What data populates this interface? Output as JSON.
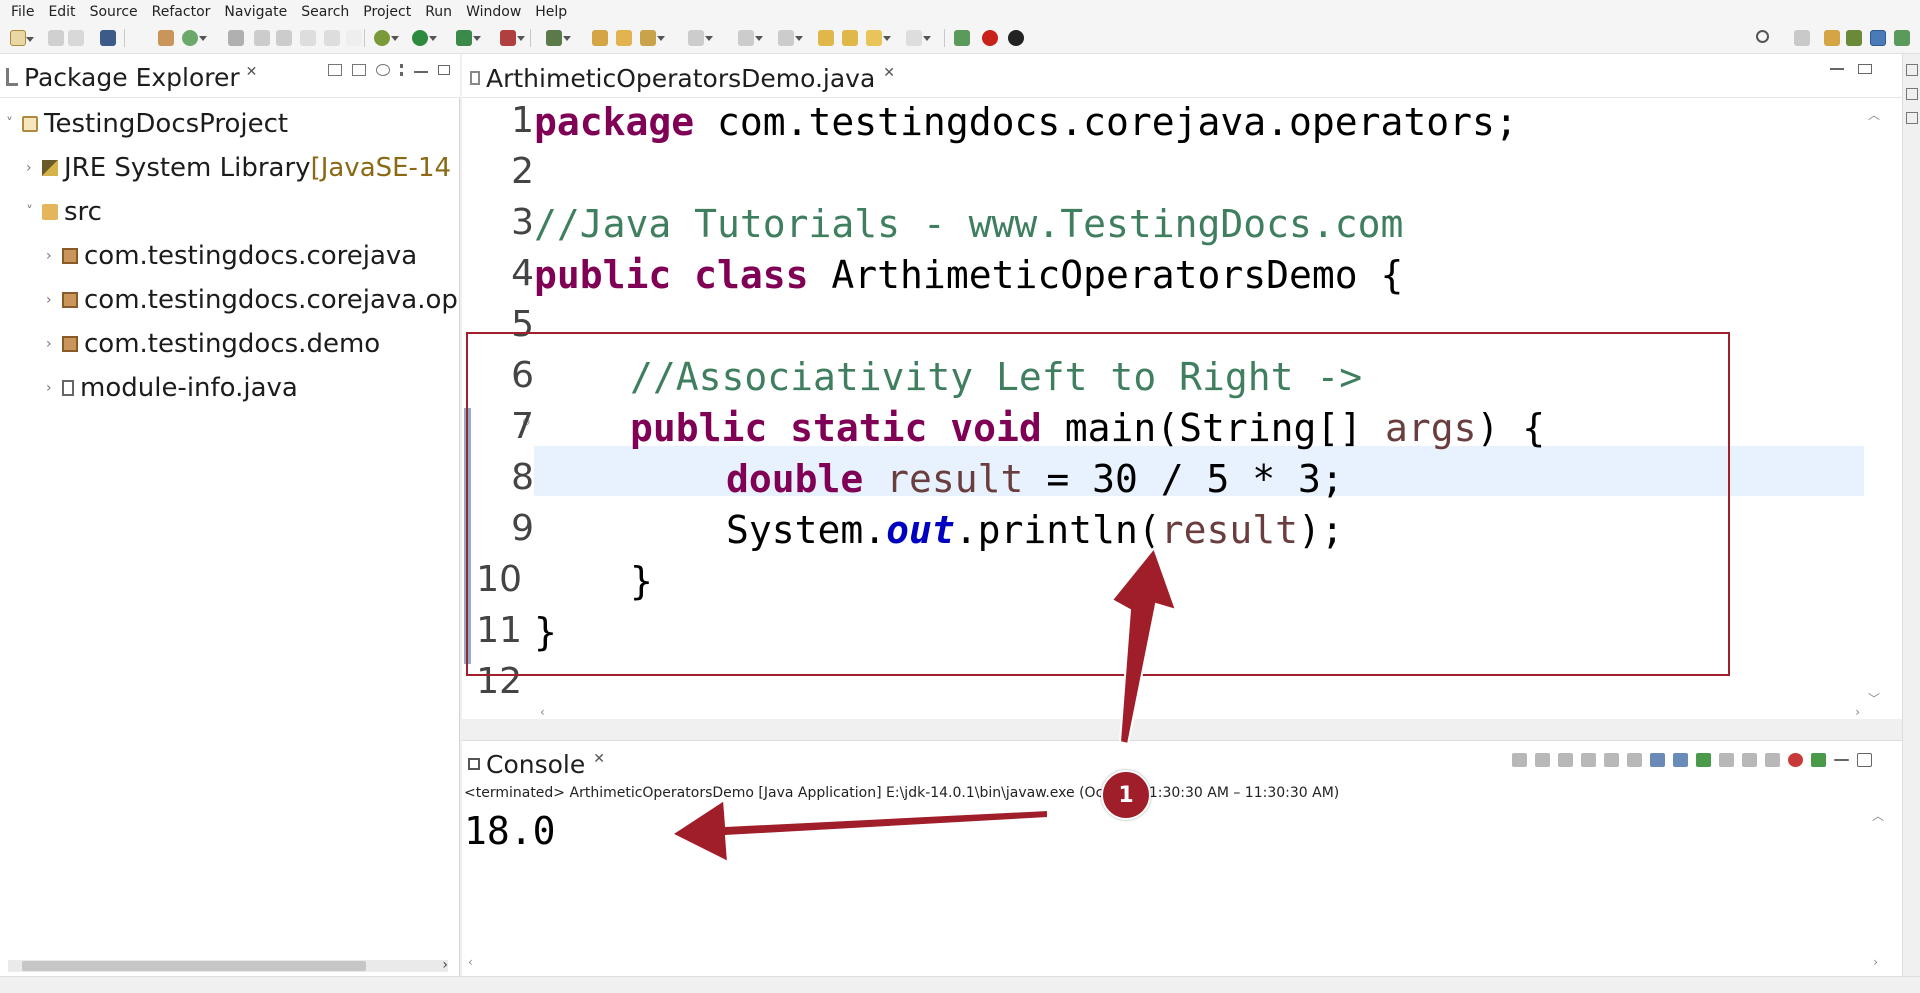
{
  "menu": [
    "File",
    "Edit",
    "Source",
    "Refactor",
    "Navigate",
    "Search",
    "Project",
    "Run",
    "Window",
    "Help"
  ],
  "package_explorer": {
    "title": "Package Explorer",
    "tree": [
      {
        "label": "TestingDocsProject",
        "suffix": "",
        "icon": "project-icon",
        "twisty": "˅"
      },
      {
        "label": "JRE System Library ",
        "suffix": "[JavaSE-14",
        "icon": "library-icon",
        "twisty": "›"
      },
      {
        "label": "src",
        "suffix": "",
        "icon": "source-folder-icon",
        "twisty": "˅"
      },
      {
        "label": "com.testingdocs.corejava",
        "suffix": "",
        "icon": "package-icon",
        "twisty": "›"
      },
      {
        "label": "com.testingdocs.corejava.op",
        "suffix": "",
        "icon": "package-icon",
        "twisty": "›"
      },
      {
        "label": "com.testingdocs.demo",
        "suffix": "",
        "icon": "package-icon",
        "twisty": "›"
      },
      {
        "label": "module-info.java",
        "suffix": "",
        "icon": "java-file-icon",
        "twisty": "›"
      }
    ]
  },
  "editor": {
    "tab_title": "ArthimeticOperatorsDemo.java",
    "line_numbers": [
      "1",
      "2",
      "3",
      "4",
      "5",
      "6",
      "7",
      "8",
      "9",
      "10",
      "11",
      "12"
    ],
    "lines": {
      "l1_kw": "package",
      "l1_rest": " com.testingdocs.corejava.operators;",
      "l3_comment": "//Java Tutorials - www.TestingDocs.com",
      "l4_kw": "public class",
      "l4_rest": " ArthimeticOperatorsDemo {",
      "l6_comment": "//Associativity Left to Right ->",
      "l7_kw": "public static void",
      "l7_mid": " main(String[] ",
      "l7_var": "args",
      "l7_end": ") {",
      "l8_kw": "double",
      "l8_sp": " ",
      "l8_var": "result",
      "l8_rest": " = 30 / 5 * 3;",
      "l9_a": "System.",
      "l9_field": "out",
      "l9_b": ".println(",
      "l9_var": "result",
      "l9_c": ");",
      "l10": "}",
      "l11": "}"
    }
  },
  "console": {
    "title": "Console",
    "status": "<terminated> ArthimeticOperatorsDemo [Java Application] E:\\jdk-14.0.1\\bin\\javaw.exe  (Oct 31,         11:30:30 AM – 11:30:30 AM)",
    "output": "18.0"
  },
  "annotation": {
    "badge": "1",
    "color": "#a01e2a"
  }
}
